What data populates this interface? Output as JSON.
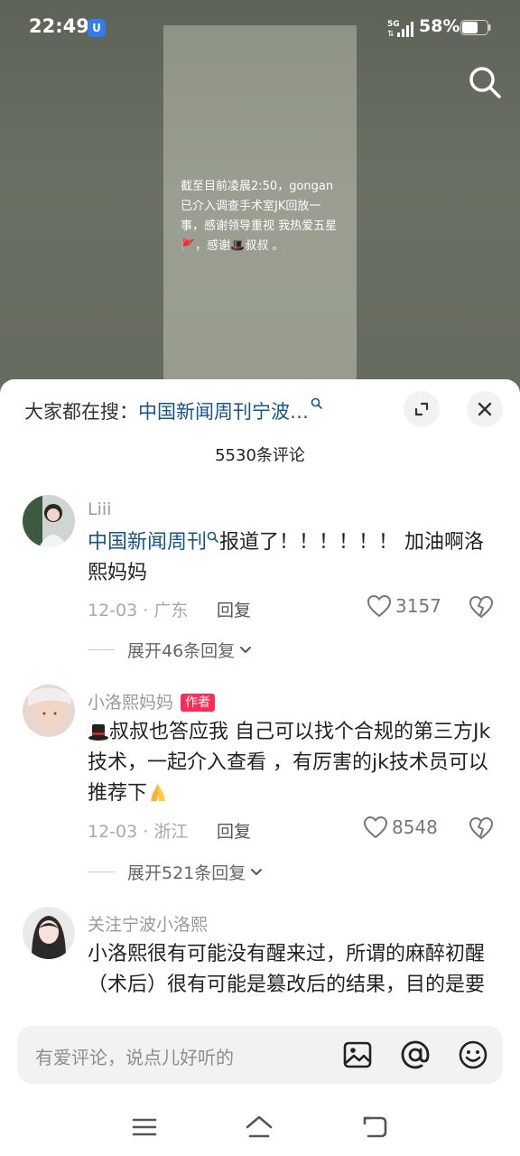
{
  "status_bar": {
    "time": "22:49",
    "badge": "U",
    "network": "5G",
    "battery": "58%"
  },
  "video": {
    "caption": "截至目前凌晨2:50，gongan已介入调查手术室JK回放一事，感谢领导重视 我热爱五星🚩，感谢🎩叔叔 。"
  },
  "header": {
    "hot_search_prefix": "大家都在搜：",
    "hot_search_term": "中国新闻周刊宁波…",
    "comment_count": "5530条评论"
  },
  "comments": [
    {
      "username": "Liii",
      "link_text": "中国新闻周刊",
      "text": "报道了！！！！！！ 加油啊洛熙妈妈",
      "date": "12-03",
      "location": "广东",
      "reply_label": "回复",
      "likes": "3157",
      "expand_label": "展开46条回复"
    },
    {
      "username": "小洛熙妈妈",
      "author_tag": "作者",
      "text": "叔叔也答应我 自己可以找个合规的第三方Jk技术，一起介入查看 ，有厉害的jk技术员可以推荐下",
      "date": "12-03",
      "location": "浙江",
      "reply_label": "回复",
      "likes": "8548",
      "expand_label": "展开521条回复"
    },
    {
      "username": "关注宁波小洛熙",
      "text": "小洛熙很有可能没有醒来过，所谓的麻醉初醒（术后）很有可能是篡改后的结果，目的是要大家义愤填膺，四处传播，最后却"
    }
  ],
  "input": {
    "placeholder": "有爱评论，说点儿好听的"
  },
  "colors": {
    "link": "#14548f",
    "author_tag": "#fe2c55",
    "badge": "#2f7cf6"
  }
}
